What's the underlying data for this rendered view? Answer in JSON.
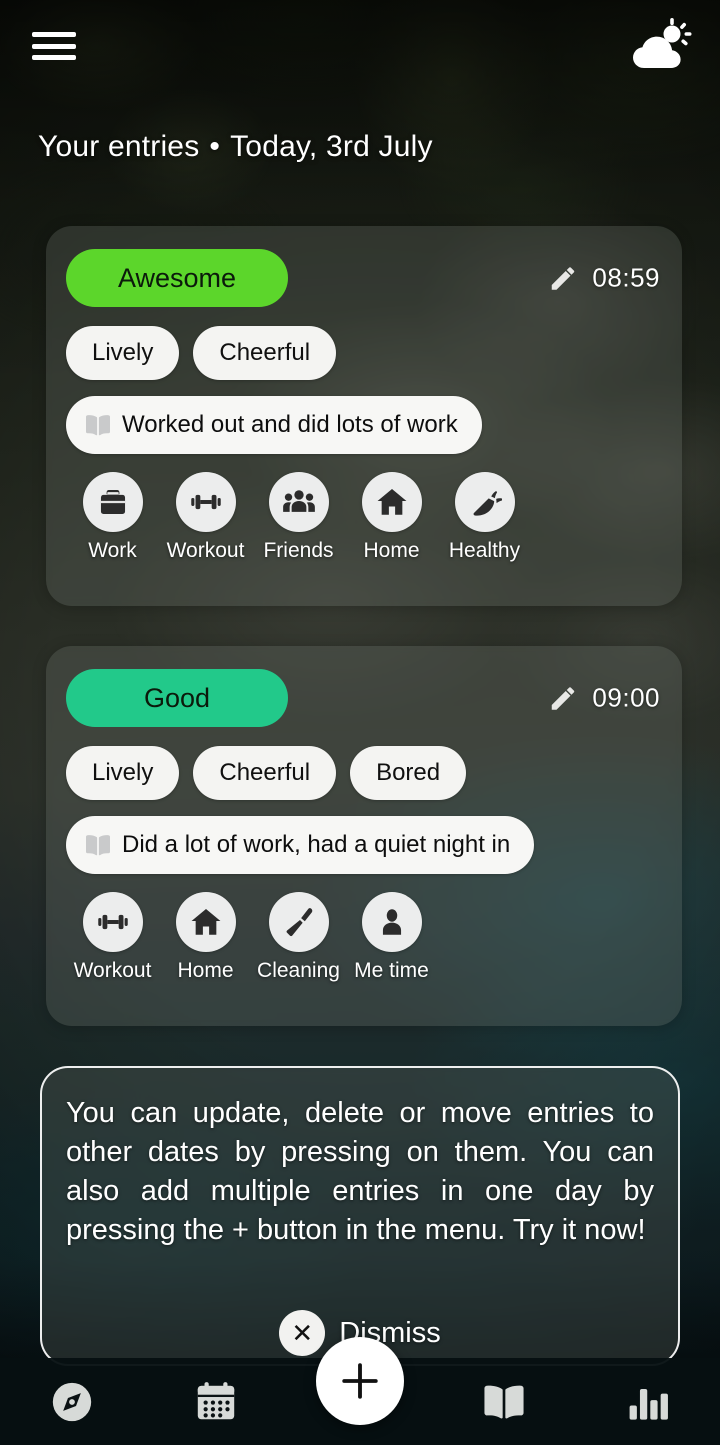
{
  "header": {
    "menu_icon": "hamburger-menu-icon",
    "weather_icon": "partly-cloudy-icon",
    "title_main": "Your entries",
    "title_separator": "•",
    "title_date": "Today, 3rd July"
  },
  "colors": {
    "mood_awesome": "#5cd62b",
    "mood_good": "#22c98a",
    "pill_text": "#0b1a0b",
    "chip_bg": "#f4f4f2",
    "nav_bg": "#061012",
    "fab_bg": "#ffffff"
  },
  "entries": [
    {
      "mood": "Awesome",
      "mood_color": "#5cd62b",
      "time": "08:59",
      "edit_icon": "pencil-icon",
      "feelings": [
        "Lively",
        "Cheerful"
      ],
      "note_icon": "book-icon",
      "note": "Worked out and did lots of work",
      "activities": [
        {
          "label": "Work",
          "icon": "briefcase-icon"
        },
        {
          "label": "Workout",
          "icon": "dumbbell-icon"
        },
        {
          "label": "Friends",
          "icon": "people-icon"
        },
        {
          "label": "Home",
          "icon": "house-icon"
        },
        {
          "label": "Healthy",
          "icon": "carrot-icon"
        }
      ]
    },
    {
      "mood": "Good",
      "mood_color": "#22c98a",
      "time": "09:00",
      "edit_icon": "pencil-icon",
      "feelings": [
        "Lively",
        "Cheerful",
        "Bored"
      ],
      "note_icon": "book-icon",
      "note": "Did a lot of work, had a quiet night in",
      "activities": [
        {
          "label": "Workout",
          "icon": "dumbbell-icon"
        },
        {
          "label": "Home",
          "icon": "house-icon"
        },
        {
          "label": "Cleaning",
          "icon": "broom-icon"
        },
        {
          "label": "Me time",
          "icon": "person-icon"
        }
      ]
    }
  ],
  "hint": {
    "text": "You can update, delete or move entries to other dates by pressing on them. You can also add multiple entries in one day by pressing the + button in the menu. Try it now!",
    "dismiss_icon": "close-icon",
    "dismiss_label": "Dismiss"
  },
  "bottom_nav": {
    "items": [
      {
        "name": "nav-discover",
        "icon": "compass-icon"
      },
      {
        "name": "nav-calendar",
        "icon": "calendar-icon"
      },
      {
        "name": "nav-diary",
        "icon": "book-open-icon"
      },
      {
        "name": "nav-stats",
        "icon": "bar-chart-icon"
      }
    ],
    "fab_icon": "plus-icon"
  }
}
